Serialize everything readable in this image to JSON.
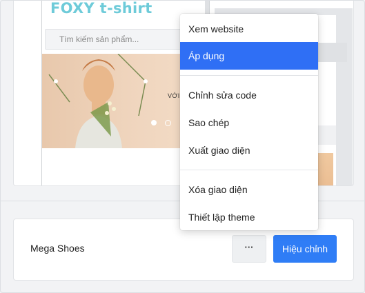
{
  "preview": {
    "store_title": "FOXY t-shirt",
    "search_placeholder": "Tìm kiếm sản phẩm...",
    "banner_text": "VỚI"
  },
  "menu": {
    "items": [
      {
        "label": "Xem website"
      },
      {
        "label": "Áp dụng"
      },
      {
        "label": "Chỉnh sửa code"
      },
      {
        "label": "Sao chép"
      },
      {
        "label": "Xuất giao diện"
      },
      {
        "label": "Xóa giao diện"
      },
      {
        "label": "Thiết lập theme"
      }
    ],
    "active_index": 1
  },
  "theme_card": {
    "name": "Mega Shoes",
    "more_label": "···",
    "edit_label": "Hiệu chỉnh"
  },
  "colors": {
    "accent": "#2f7df6",
    "store_title": "#6ecbd9"
  }
}
